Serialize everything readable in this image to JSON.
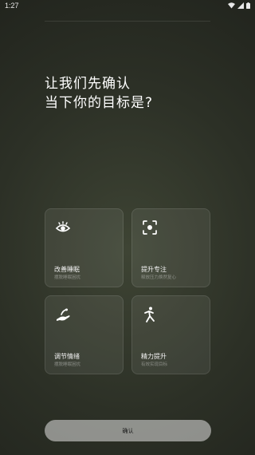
{
  "status_bar": {
    "time": "1:27"
  },
  "headline": {
    "line1": "让我们先确认",
    "line2": "当下你的目标是?"
  },
  "options": [
    {
      "title": "改善睡眠",
      "subtitle": "摆脱睡眠困扰",
      "icon": "eye-icon"
    },
    {
      "title": "提升专注",
      "subtitle": "释放压力焕然复心",
      "icon": "focus-frame-icon"
    },
    {
      "title": "调节情绪",
      "subtitle": "摆脱睡眠困扰",
      "icon": "hand-icon"
    },
    {
      "title": "精力提升",
      "subtitle": "有效实现目标",
      "icon": "walking-person-icon"
    }
  ],
  "confirm_button": {
    "label": "确认"
  }
}
